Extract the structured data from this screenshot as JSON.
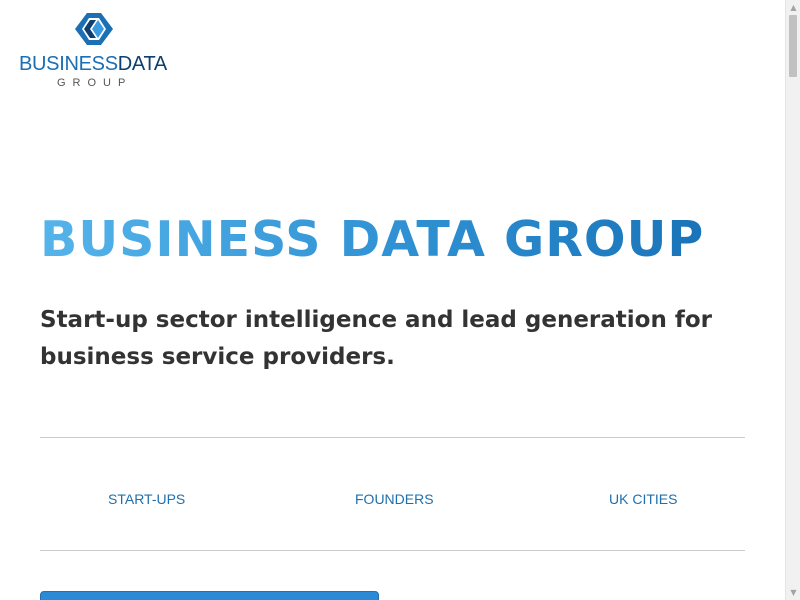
{
  "logo": {
    "word_part1": "BUSINESS",
    "word_part2": "DATA",
    "subtitle": "GROUP",
    "icon": "bdg-logo-mark-icon",
    "colors": {
      "primary": "#1a6fb5",
      "dark": "#0e3f6e",
      "light": "#3b9be0"
    }
  },
  "hero": {
    "title": "BUSINESS DATA GROUP",
    "subtitle": "Start-up sector intelligence and lead generation for business service providers.",
    "title_gradient": [
      "#55b4ea",
      "#2f91d3",
      "#1a73b8"
    ]
  },
  "nav": {
    "links": [
      "START-UPS",
      "FOUNDERS",
      "UK CITIES"
    ],
    "link_color": "#1f6fae"
  },
  "cta": {
    "color": "#2a8ad6"
  },
  "scrollbar": {
    "up_icon": "scroll-up-arrow-icon",
    "down_icon": "scroll-down-arrow-icon"
  }
}
